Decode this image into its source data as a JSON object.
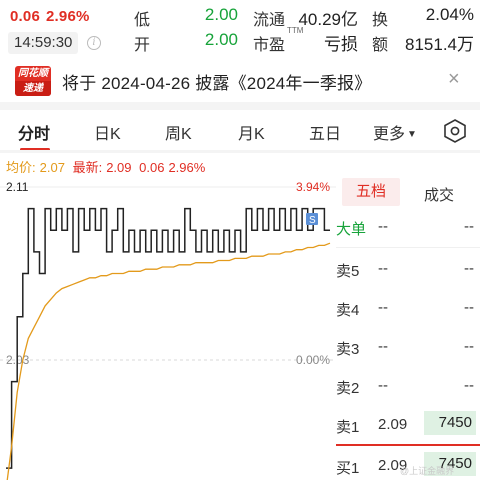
{
  "quote": {
    "change": "0.06",
    "change_pct": "2.96%",
    "time": "14:59:30",
    "low_label": "低",
    "low_value": "2.00",
    "open_label": "开",
    "open_value": "2.00",
    "float_label": "流通",
    "float_value": "40.29亿",
    "pe_label": "市盈",
    "pe_tm": "TTM",
    "pe_value": "亏损",
    "turnover_label": "换",
    "turnover_value": "2.04%",
    "amount_label": "额",
    "amount_value": "8151.4万"
  },
  "notice": {
    "logo_line1": "同花顺",
    "logo_line2": "速递",
    "text": "将于 2024-04-26 披露《2024年一季报》",
    "close": "×"
  },
  "tabs": [
    {
      "label": "分时",
      "active": true
    },
    {
      "label": "日K"
    },
    {
      "label": "周K"
    },
    {
      "label": "月K"
    },
    {
      "label": "五日"
    },
    {
      "label": "更多"
    }
  ],
  "more_caret": "▼",
  "chart_header": {
    "avg_label": "均价:",
    "avg_value": "2.07",
    "latest_label": "最新:",
    "latest_value": "2.09",
    "latest_change": "0.06",
    "latest_pct": "2.96%"
  },
  "chart_data": {
    "type": "line",
    "y_top_label": "2.11",
    "y_mid_label": "2.03",
    "pct_top_label": "3.94%",
    "pct_mid_label": "0.00%",
    "ylim": [
      1.95,
      2.11
    ],
    "prev_close": 2.03,
    "marker_label": "S",
    "series": [
      {
        "role": "price",
        "color": "#222222",
        "values": [
          1.98,
          2.02,
          2.05,
          2.07,
          2.1,
          2.08,
          2.07,
          2.1,
          2.09,
          2.1,
          2.09,
          2.1,
          2.08,
          2.1,
          2.09,
          2.1,
          2.09,
          2.1,
          2.08,
          2.09,
          2.1,
          2.08,
          2.09,
          2.08,
          2.09,
          2.08,
          2.09,
          2.08,
          2.09,
          2.08,
          2.09,
          2.08,
          2.1,
          2.09,
          2.08,
          2.09,
          2.08,
          2.09,
          2.08,
          2.09,
          2.08,
          2.09,
          2.08,
          2.1,
          2.09,
          2.1,
          2.09,
          2.1,
          2.09,
          2.1,
          2.09,
          2.1,
          2.09,
          2.1,
          2.09,
          2.1,
          2.1,
          2.09,
          2.09
        ]
      },
      {
        "role": "average",
        "color": "#e39a1b",
        "values": [
          1.97,
          1.99,
          2.015,
          2.03,
          2.04,
          2.045,
          2.05,
          2.055,
          2.058,
          2.061,
          2.063,
          2.064,
          2.065,
          2.066,
          2.067,
          2.068,
          2.068,
          2.069,
          2.069,
          2.07,
          2.07,
          2.07,
          2.071,
          2.071,
          2.071,
          2.072,
          2.072,
          2.072,
          2.073,
          2.073,
          2.073,
          2.074,
          2.074,
          2.074,
          2.075,
          2.075,
          2.075,
          2.075,
          2.076,
          2.076,
          2.076,
          2.077,
          2.077,
          2.077,
          2.078,
          2.078,
          2.078,
          2.079,
          2.079,
          2.079,
          2.08,
          2.08,
          2.081,
          2.081,
          2.082,
          2.082,
          2.083,
          2.083,
          2.084
        ]
      }
    ]
  },
  "panel": {
    "tab_wudang": "五档",
    "tab_chengjiao": "成交",
    "rows": [
      {
        "label": "大单",
        "price": "--",
        "vol": "--",
        "style": "g"
      },
      {
        "label": "卖5",
        "price": "--",
        "vol": "--"
      },
      {
        "label": "卖4",
        "price": "--",
        "vol": "--"
      },
      {
        "label": "卖3",
        "price": "--",
        "vol": "--"
      },
      {
        "label": "卖2",
        "price": "--",
        "vol": "--"
      },
      {
        "label": "卖1",
        "price": "2.09",
        "vol": "7450"
      },
      {
        "label": "买1",
        "price": "2.09",
        "vol": "7450"
      }
    ]
  },
  "watermark": "@上证金融界"
}
